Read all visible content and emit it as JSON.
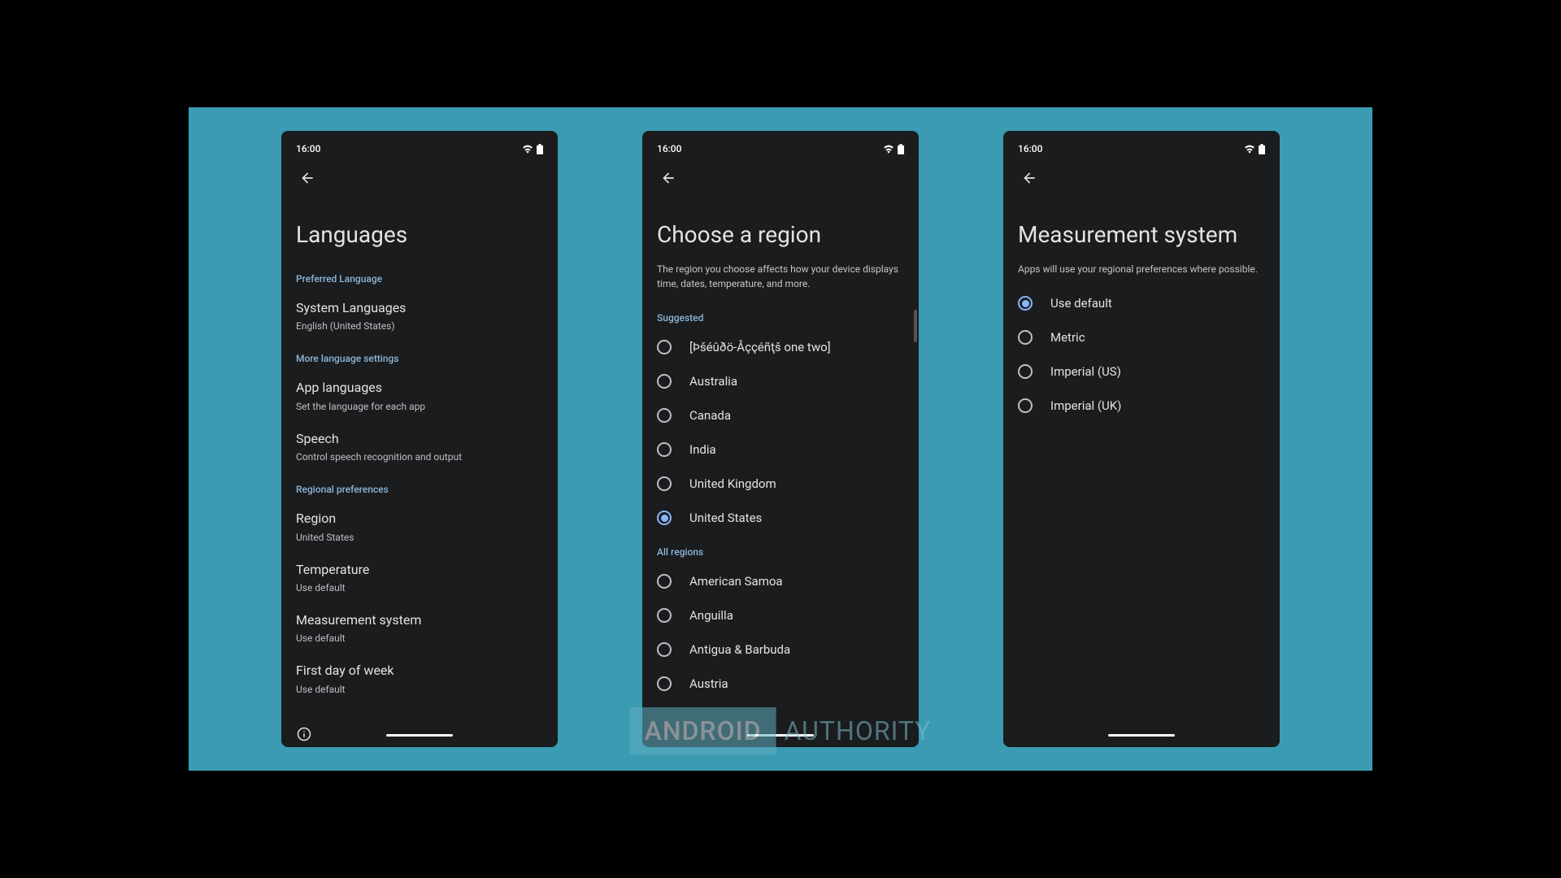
{
  "status": {
    "time": "16:00"
  },
  "screens": {
    "languages": {
      "title": "Languages",
      "sections": [
        {
          "header": "Preferred Language",
          "items": [
            {
              "title": "System Languages",
              "subtitle": "English (United States)"
            }
          ]
        },
        {
          "header": "More language settings",
          "items": [
            {
              "title": "App languages",
              "subtitle": "Set the language for each app"
            },
            {
              "title": "Speech",
              "subtitle": "Control speech recognition and output"
            }
          ]
        },
        {
          "header": "Regional preferences",
          "items": [
            {
              "title": "Region",
              "subtitle": "United States"
            },
            {
              "title": "Temperature",
              "subtitle": "Use default"
            },
            {
              "title": "Measurement system",
              "subtitle": "Use default"
            },
            {
              "title": "First day of week",
              "subtitle": "Use default"
            }
          ]
        }
      ]
    },
    "region": {
      "title": "Choose a region",
      "subtitle": "The region you choose affects how your device displays time, dates, temperature, and more.",
      "suggested_header": "Suggested",
      "suggested": [
        {
          "label": "[Þšéûðö-Åççéñţš one two]",
          "selected": false
        },
        {
          "label": "Australia",
          "selected": false
        },
        {
          "label": "Canada",
          "selected": false
        },
        {
          "label": "India",
          "selected": false
        },
        {
          "label": "United Kingdom",
          "selected": false
        },
        {
          "label": "United States",
          "selected": true
        }
      ],
      "all_header": "All regions",
      "all": [
        {
          "label": "American Samoa",
          "selected": false
        },
        {
          "label": "Anguilla",
          "selected": false
        },
        {
          "label": "Antigua & Barbuda",
          "selected": false
        },
        {
          "label": "Austria",
          "selected": false
        }
      ]
    },
    "measurement": {
      "title": "Measurement system",
      "subtitle": "Apps will use your regional preferences where possible.",
      "options": [
        {
          "label": "Use default",
          "selected": true
        },
        {
          "label": "Metric",
          "selected": false
        },
        {
          "label": "Imperial (US)",
          "selected": false
        },
        {
          "label": "Imperial (UK)",
          "selected": false
        }
      ]
    }
  },
  "watermark": {
    "boxed": "ANDROID",
    "rest": "AUTHORITY"
  }
}
